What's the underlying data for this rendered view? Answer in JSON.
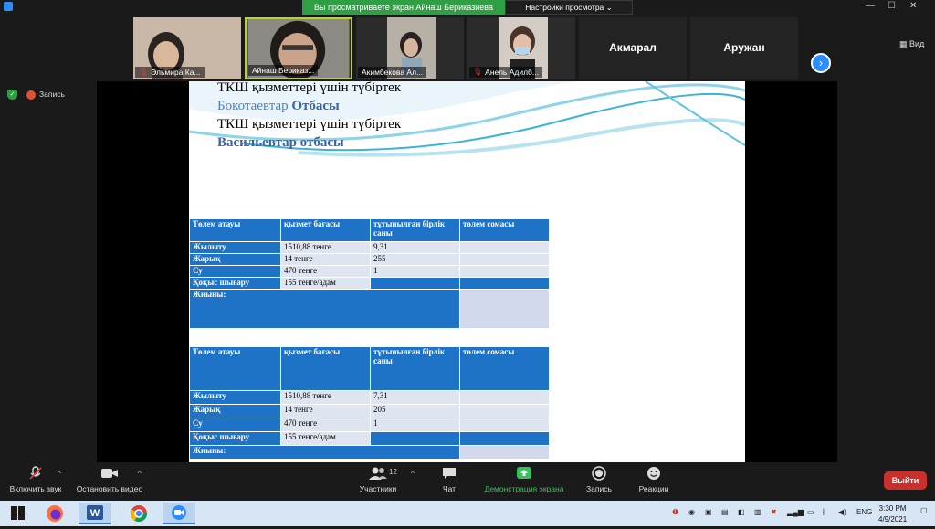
{
  "window": {
    "share_banner": "Вы просматриваете экран Айнаш Бериказиева",
    "view_options": "Настройки просмотра",
    "view_label": "Вид"
  },
  "participants": [
    {
      "name": "Эльмира Ка..."
    },
    {
      "name": "Айнаш Бериказ..."
    },
    {
      "name": "Акимбекова Ал..."
    },
    {
      "name": "Анель Адилб..."
    },
    {
      "name": "Акмарал"
    },
    {
      "name": "Аружан"
    }
  ],
  "status": {
    "record_label": "Запись"
  },
  "document": {
    "line1": "ТКШ қызметтері үшін түбіртек",
    "line2_part1": "Бокотаевтар",
    "line2_part2": "Отбасы",
    "line3": "ТКШ қызметтері үшін түбіртек",
    "line4": "Васильевтар отбасы"
  },
  "table_headers": [
    "Төлем атауы",
    "қызмет бағасы",
    "тұтынылған бірлік саны",
    "төлем сомасы"
  ],
  "table1": {
    "rows": [
      {
        "name": "Жылыту",
        "price": "1510,88 тенге",
        "units": "9,31"
      },
      {
        "name": "Жарық",
        "price": "14 тенге",
        "units": "255"
      },
      {
        "name": "Су",
        "price": "470 тенге",
        "units": "1"
      },
      {
        "name": "Қоқыс шығару",
        "price": "155 тенге/адам",
        "units": ""
      }
    ],
    "total_label": "Жиыны:"
  },
  "table2": {
    "rows": [
      {
        "name": "Жылыту",
        "price": "1510,88 тенге",
        "units": "7,31"
      },
      {
        "name": "Жарық",
        "price": "14 тенге",
        "units": "205"
      },
      {
        "name": "Су",
        "price": "470 тенге",
        "units": "1"
      },
      {
        "name": "Қоқыс шығару",
        "price": "155 тенге/адам",
        "units": ""
      }
    ],
    "total_label": "Жиыны:"
  },
  "toolbar": {
    "audio": "Включить звук",
    "video": "Остановить видео",
    "participants": "Участники",
    "participants_count": "12",
    "chat": "Чат",
    "share": "Демонстрация экрана",
    "record": "Запись",
    "reactions": "Реакции",
    "leave": "Выйти"
  },
  "taskbar": {
    "lang": "ENG",
    "time": "3:30 PM",
    "date": "4/9/2021"
  },
  "colors": {
    "accent": "#2d8cff",
    "share_green": "#2f9e44",
    "table_header": "#1f73c7",
    "table_cell": "#dfe4f1",
    "leave": "#c9302c"
  }
}
